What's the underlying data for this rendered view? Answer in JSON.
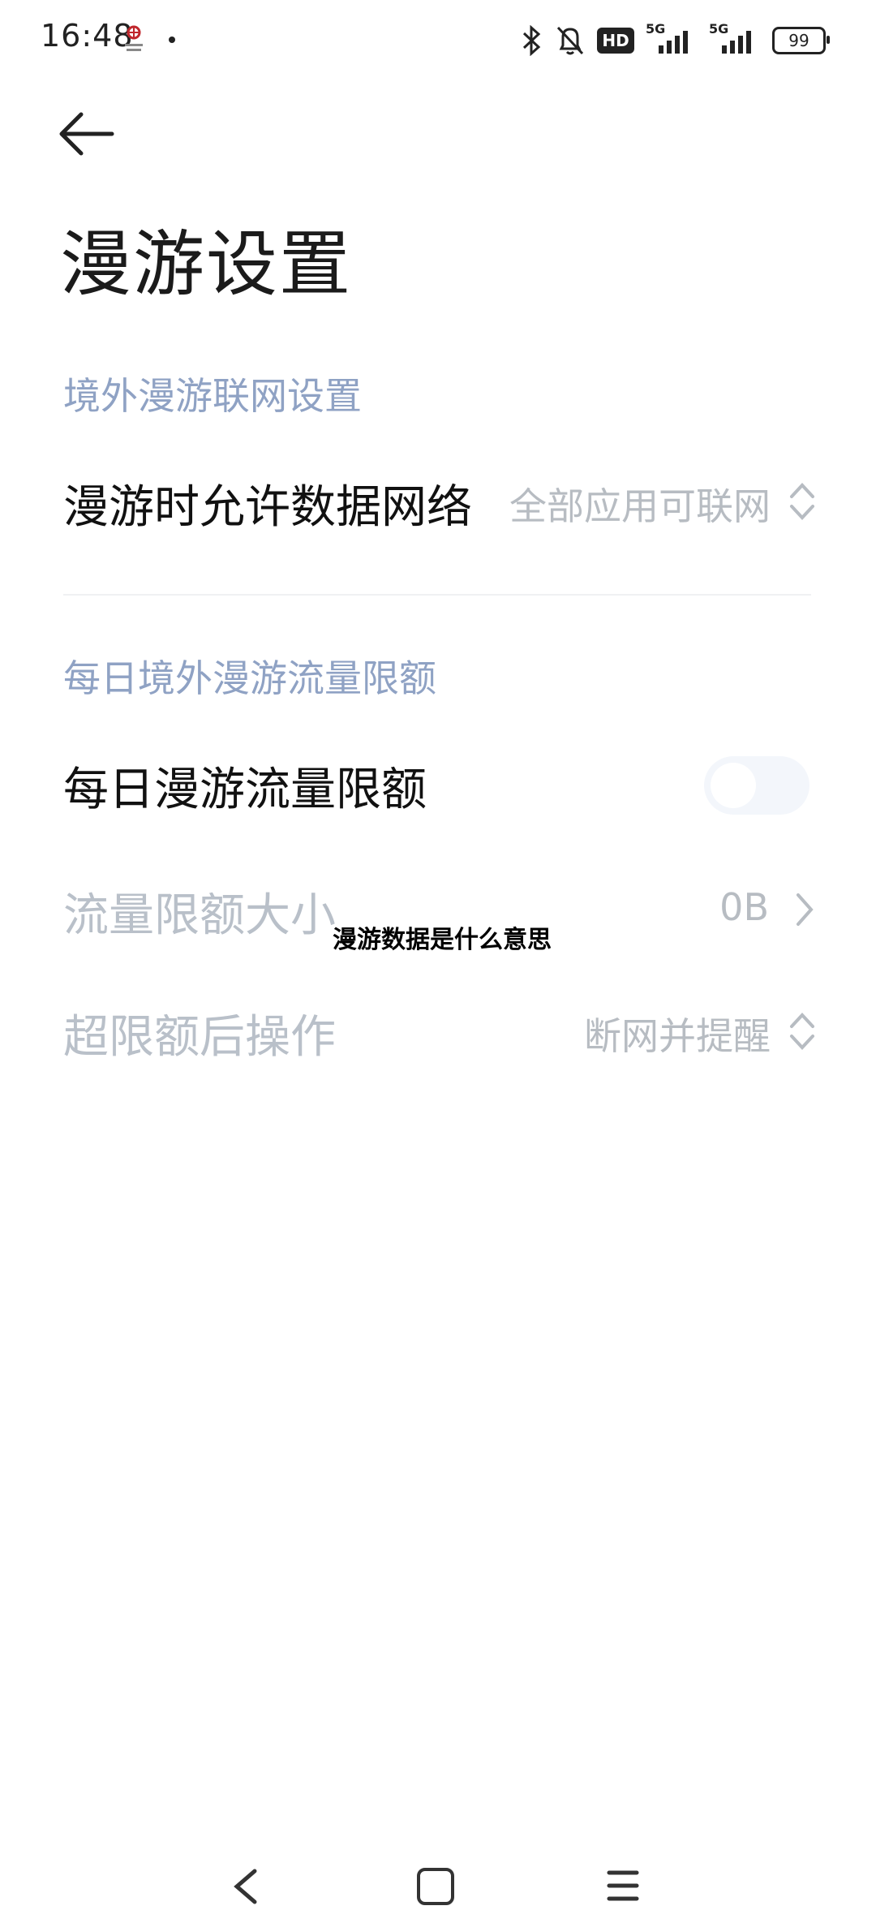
{
  "status_bar": {
    "time": "16:48",
    "battery": "99",
    "hd_label": "HD",
    "signal1_label": "5G",
    "signal2_label": "5G",
    "icons": [
      "carrier-icon",
      "bluetooth-icon",
      "mute-bell-icon",
      "signal-icon",
      "battery-icon"
    ]
  },
  "header": {
    "back_icon": "back-arrow-icon",
    "title": "漫游设置"
  },
  "section1": {
    "header": "境外漫游联网设置",
    "row": {
      "label": "漫游时允许数据网络",
      "value": "全部应用可联网"
    }
  },
  "section2": {
    "header": "每日境外漫游流量限额",
    "toggle_row": {
      "label": "每日漫游流量限额",
      "toggle_on": false
    },
    "limit_row": {
      "label": "流量限额大小",
      "value": "0B"
    },
    "action_row": {
      "label": "超限额后操作",
      "value": "断网并提醒"
    }
  },
  "overlay_caption": "漫游数据是什么意思",
  "nav_bar": {
    "items": [
      "back-icon",
      "home-icon",
      "recents-icon"
    ]
  },
  "colors": {
    "section_header": "#8fa2c4",
    "disabled_text": "#b9c0c9",
    "value_text": "#b7bcc2"
  }
}
